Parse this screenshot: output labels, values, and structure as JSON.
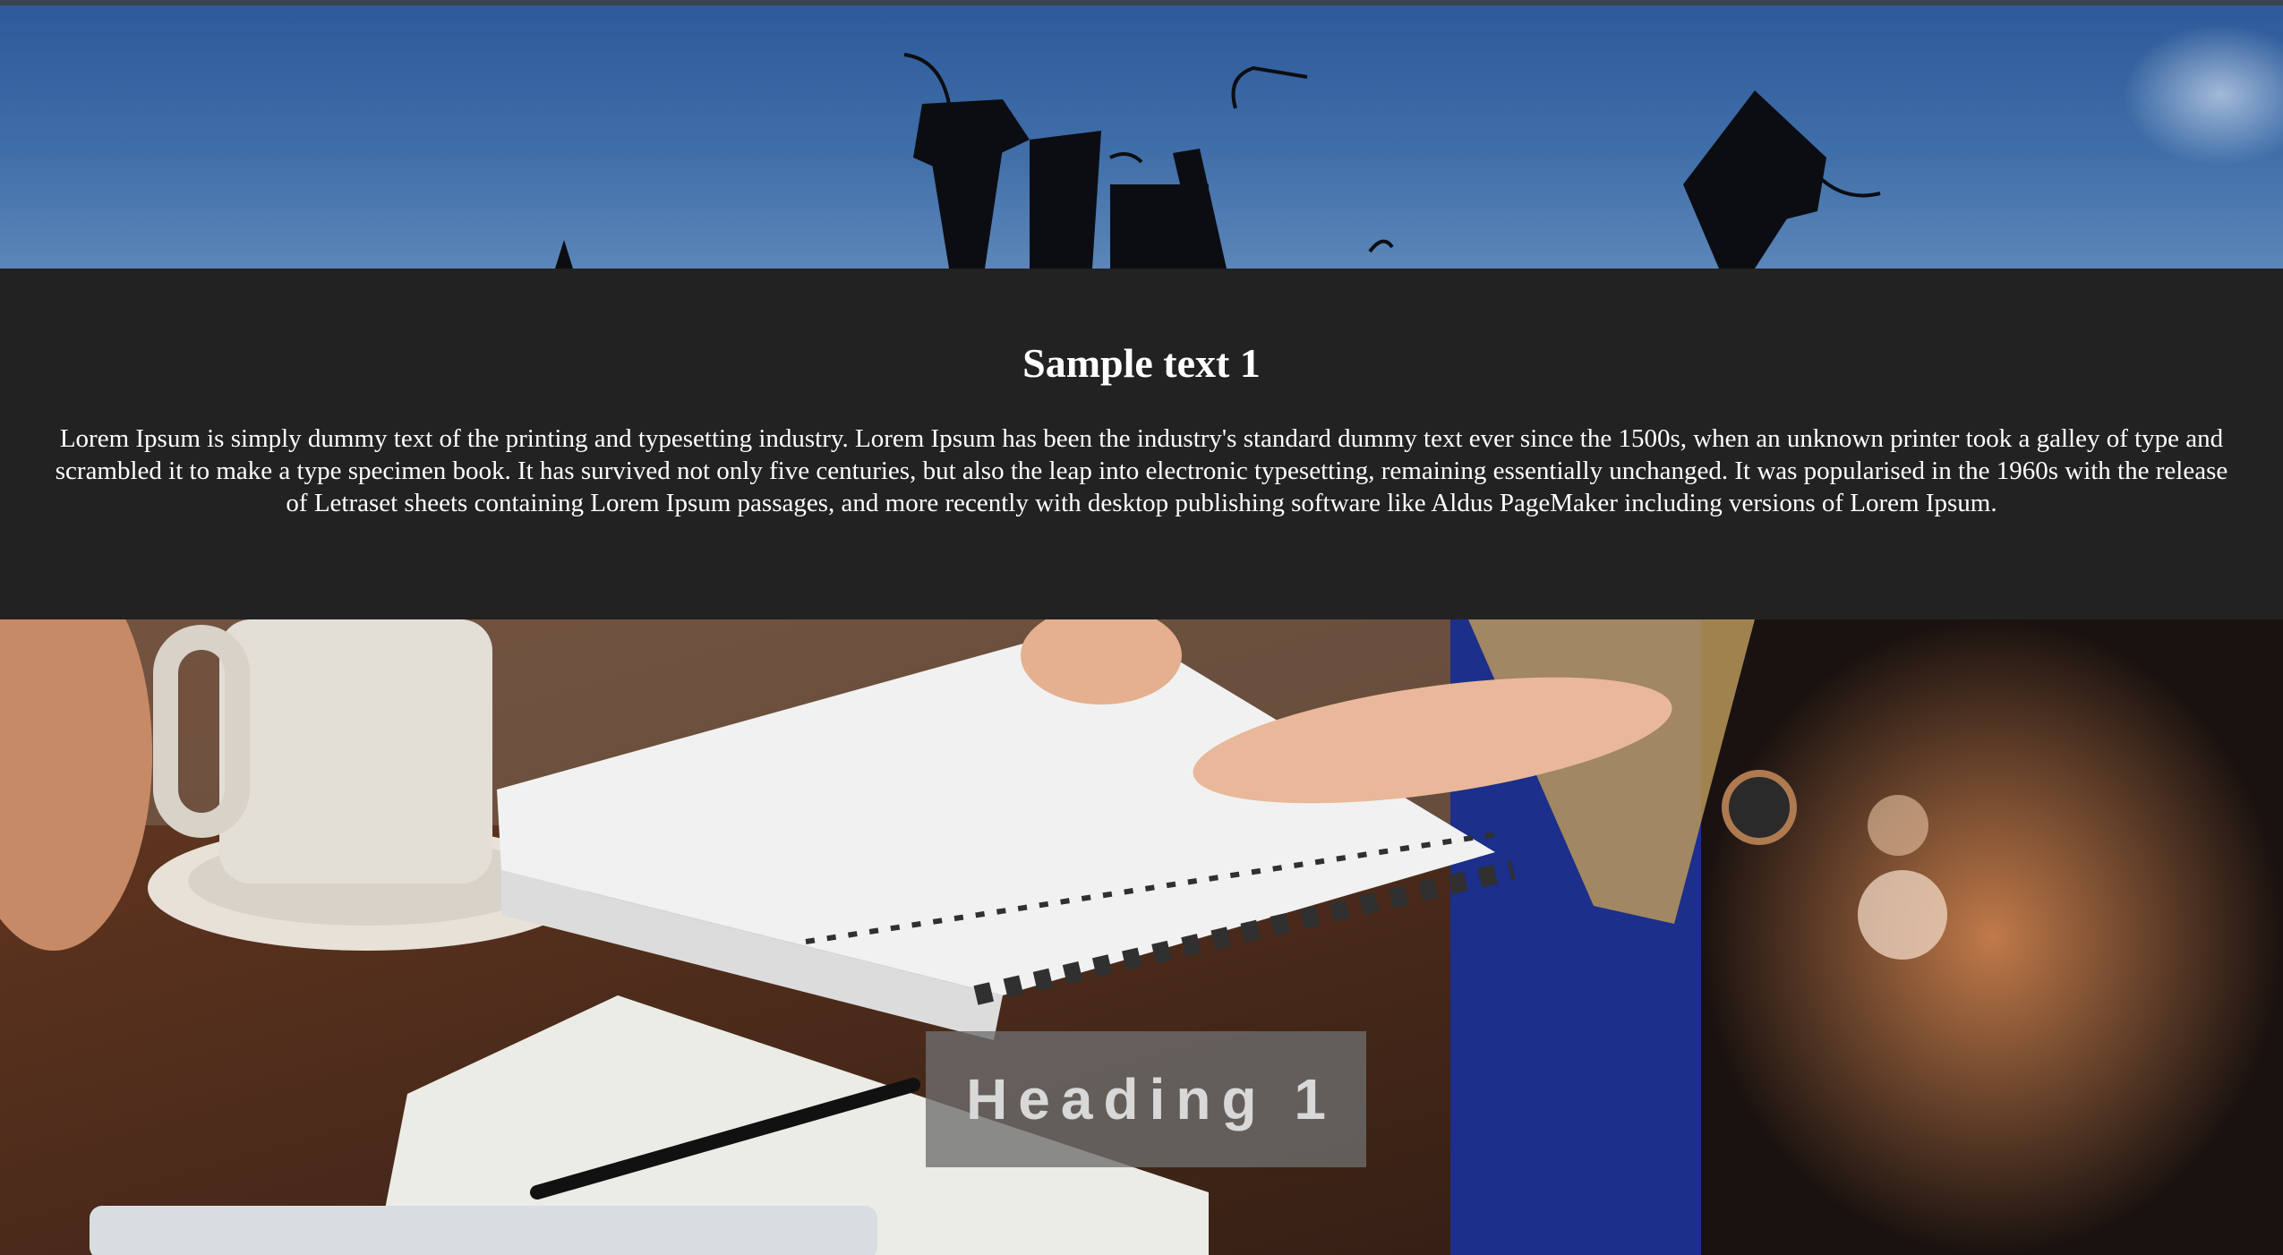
{
  "hero": {
    "image_icon": "graduation-caps-photo"
  },
  "section": {
    "title": "Sample text 1",
    "body": "Lorem Ipsum is simply dummy text of the printing and typesetting industry. Lorem Ipsum has been the industry's standard dummy text ever since the 1500s, when an unknown printer took a galley of type and scrambled it to make a type specimen book. It has survived not only five centuries, but also the leap into electronic typesetting, remaining essentially unchanged. It was popularised in the 1960s with the release of Letraset sheets containing Lorem Ipsum passages, and more recently with desktop publishing software like Aldus PageMaker including versions of Lorem Ipsum."
  },
  "photo": {
    "image_icon": "desk-study-photo",
    "heading": "Heading 1"
  },
  "colors": {
    "section_bg": "#222222",
    "text": "#ffffff",
    "sky": "#3f6ea8",
    "heading_overlay": "#6e6e6e"
  }
}
